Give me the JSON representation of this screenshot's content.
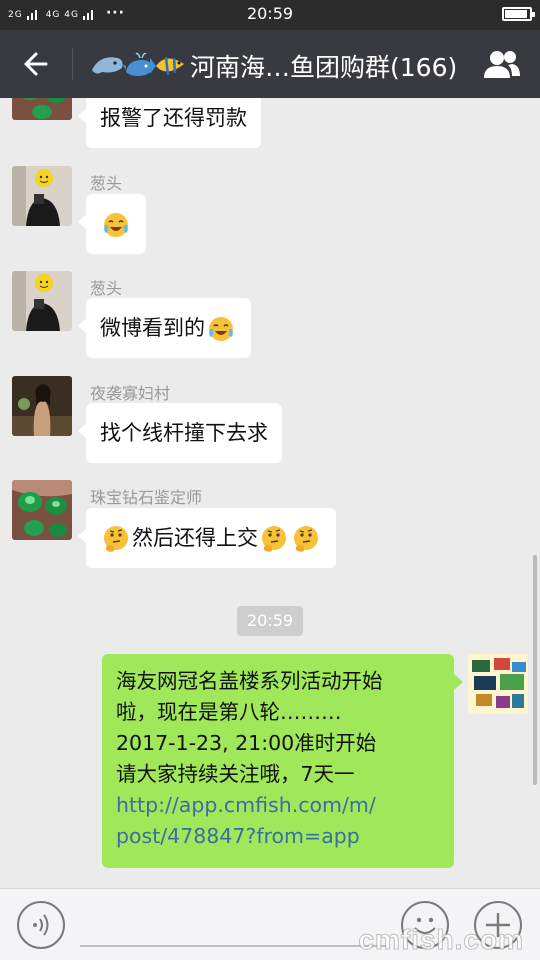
{
  "status_bar": {
    "network_left": "2G",
    "network_right": "4G 4G",
    "more_dots": "···",
    "time": "20:59"
  },
  "header": {
    "title": "河南海…鱼团购群(166)",
    "title_emoji": [
      "dolphin-emoji",
      "whale-emoji",
      "tropical-fish-emoji"
    ],
    "back_icon": "back-arrow-icon",
    "members_icon": "group-members-icon"
  },
  "messages": [
    {
      "sender": "",
      "text": "报警了还得罚款",
      "avatar": "jade-rings-avatar"
    },
    {
      "sender": "葱头",
      "text": "",
      "emojis": [
        "tears-of-joy-emoji"
      ],
      "avatar": "man-mirror-selfie-avatar"
    },
    {
      "sender": "葱头",
      "text": "微博看到的",
      "emojis": [
        "tears-of-joy-emoji"
      ],
      "avatar": "man-mirror-selfie-avatar"
    },
    {
      "sender": "夜袭寡妇村",
      "text": "找个线杆撞下去求",
      "avatar": "woman-photo-avatar"
    },
    {
      "sender": "珠宝钻石鉴定师",
      "text": "然后还得上交",
      "emojis": [
        "thinking-face-emoji"
      ],
      "avatar": "jade-rings-avatar"
    }
  ],
  "timestamp": "20:59",
  "outgoing": {
    "lines": [
      "海友网冠名盖楼系列活动开始",
      "啦，现在是第八轮………",
      "2017-1-23, 21:00准时开始",
      "请大家持续关注哦，7天一"
    ],
    "link_lines": [
      "http://app.cmfish.com/m/",
      "post/478847?from=app"
    ],
    "avatar": "aquarium-collage-avatar"
  },
  "input_bar": {
    "voice_icon": "voice-input-icon",
    "emoji_icon": "emoji-button-icon",
    "plus_icon": "more-plus-icon"
  },
  "watermark": "cmfish.com",
  "colors": {
    "status_bar_bg": "#2c2c2c",
    "title_bar_bg": "#393a3f",
    "chat_bg": "#ebebeb",
    "incoming_bubble": "#ffffff",
    "outgoing_bubble": "#a0e75a",
    "link": "#3a6ea5",
    "nick": "#999999"
  }
}
